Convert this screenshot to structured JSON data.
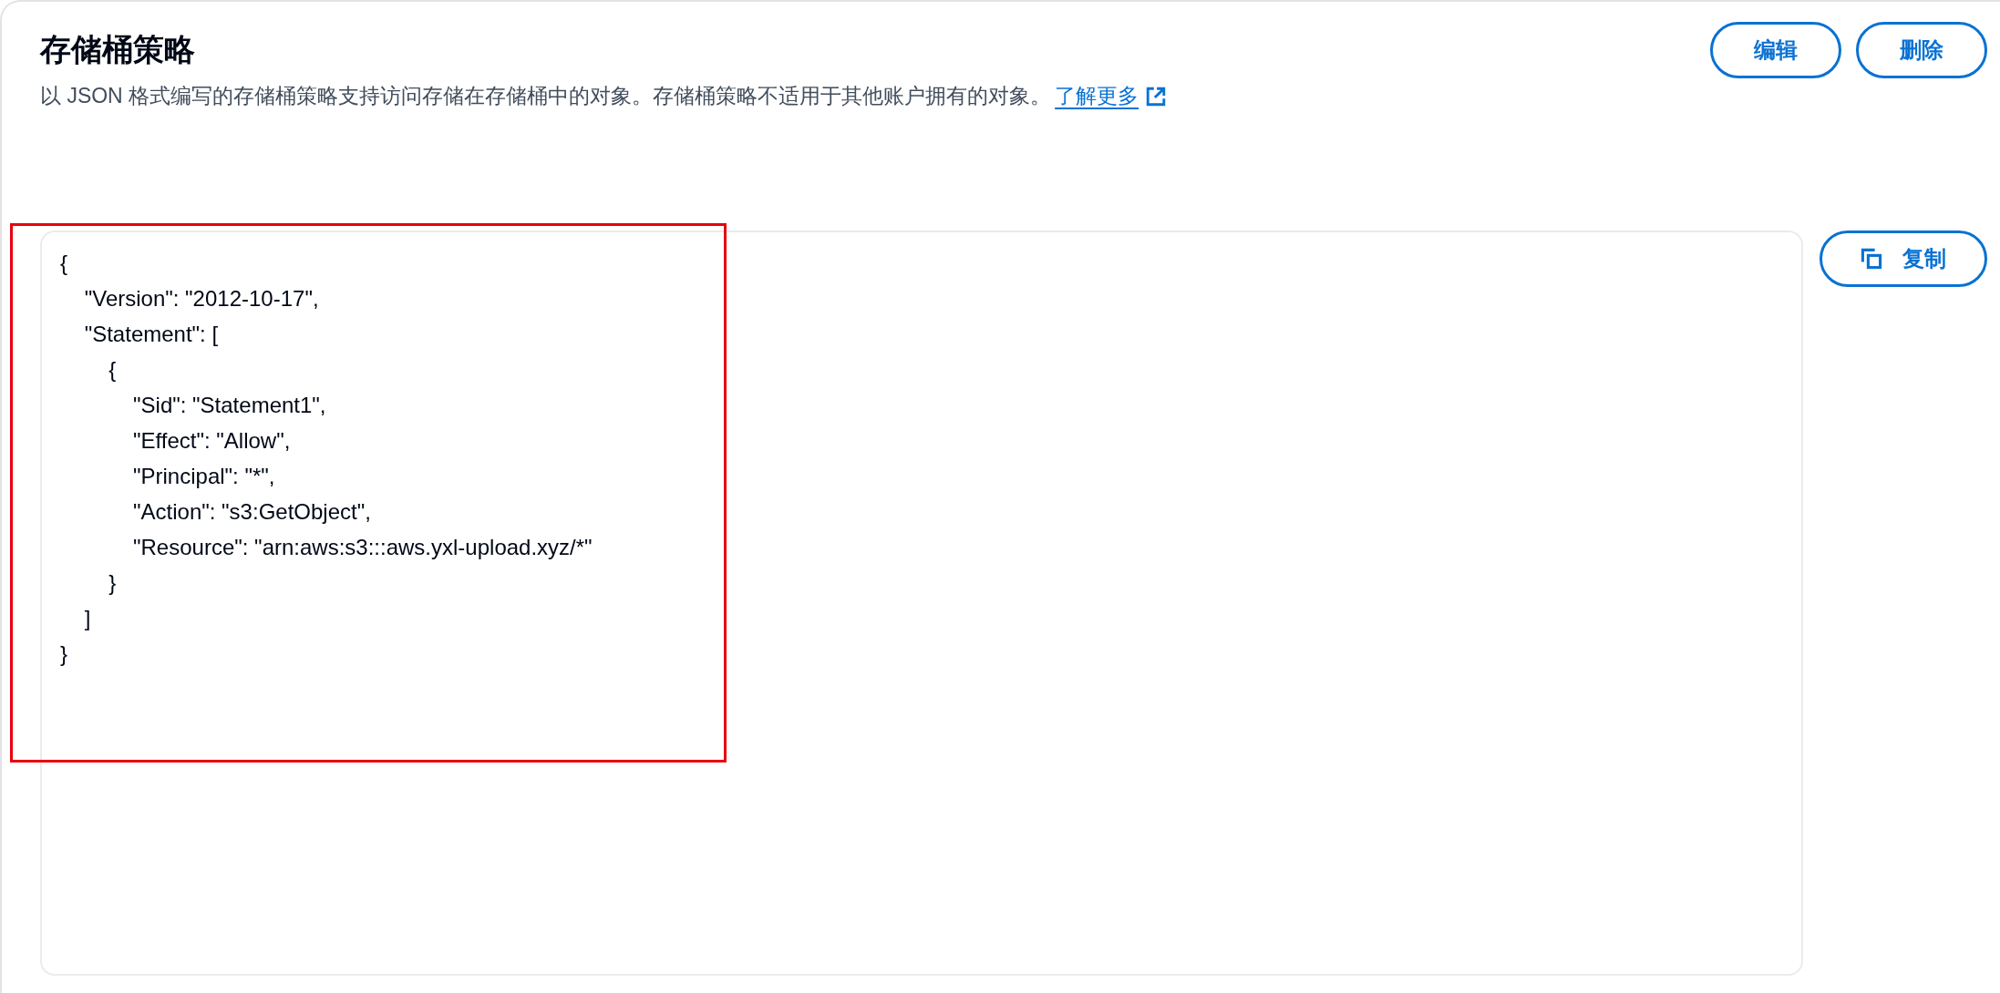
{
  "header": {
    "title": "存储桶策略",
    "description": "以 JSON 格式编写的存储桶策略支持访问存储在存储桶中的对象。存储桶策略不适用于其他账户拥有的对象。",
    "link": "了解更多"
  },
  "buttons": [
    {
      "label": "编辑"
    },
    {
      "label": "删除"
    }
  ],
  "policy": {
    "code": "{\n    \"Version\": \"2012-10-17\",\n    \"Statement\": [\n        {\n            \"Sid\": \"Statement1\",\n            \"Effect\": \"Allow\",\n            \"Principal\": \"*\",\n            \"Action\": \"s3:GetObject\",\n            \"Resource\": \"arn:aws:s3:::aws.yxl-upload.xyz/*\"\n        }\n    ]\n}",
    "copy_button": "复制"
  },
  "annotation": {
    "kind": "rectangle"
  }
}
